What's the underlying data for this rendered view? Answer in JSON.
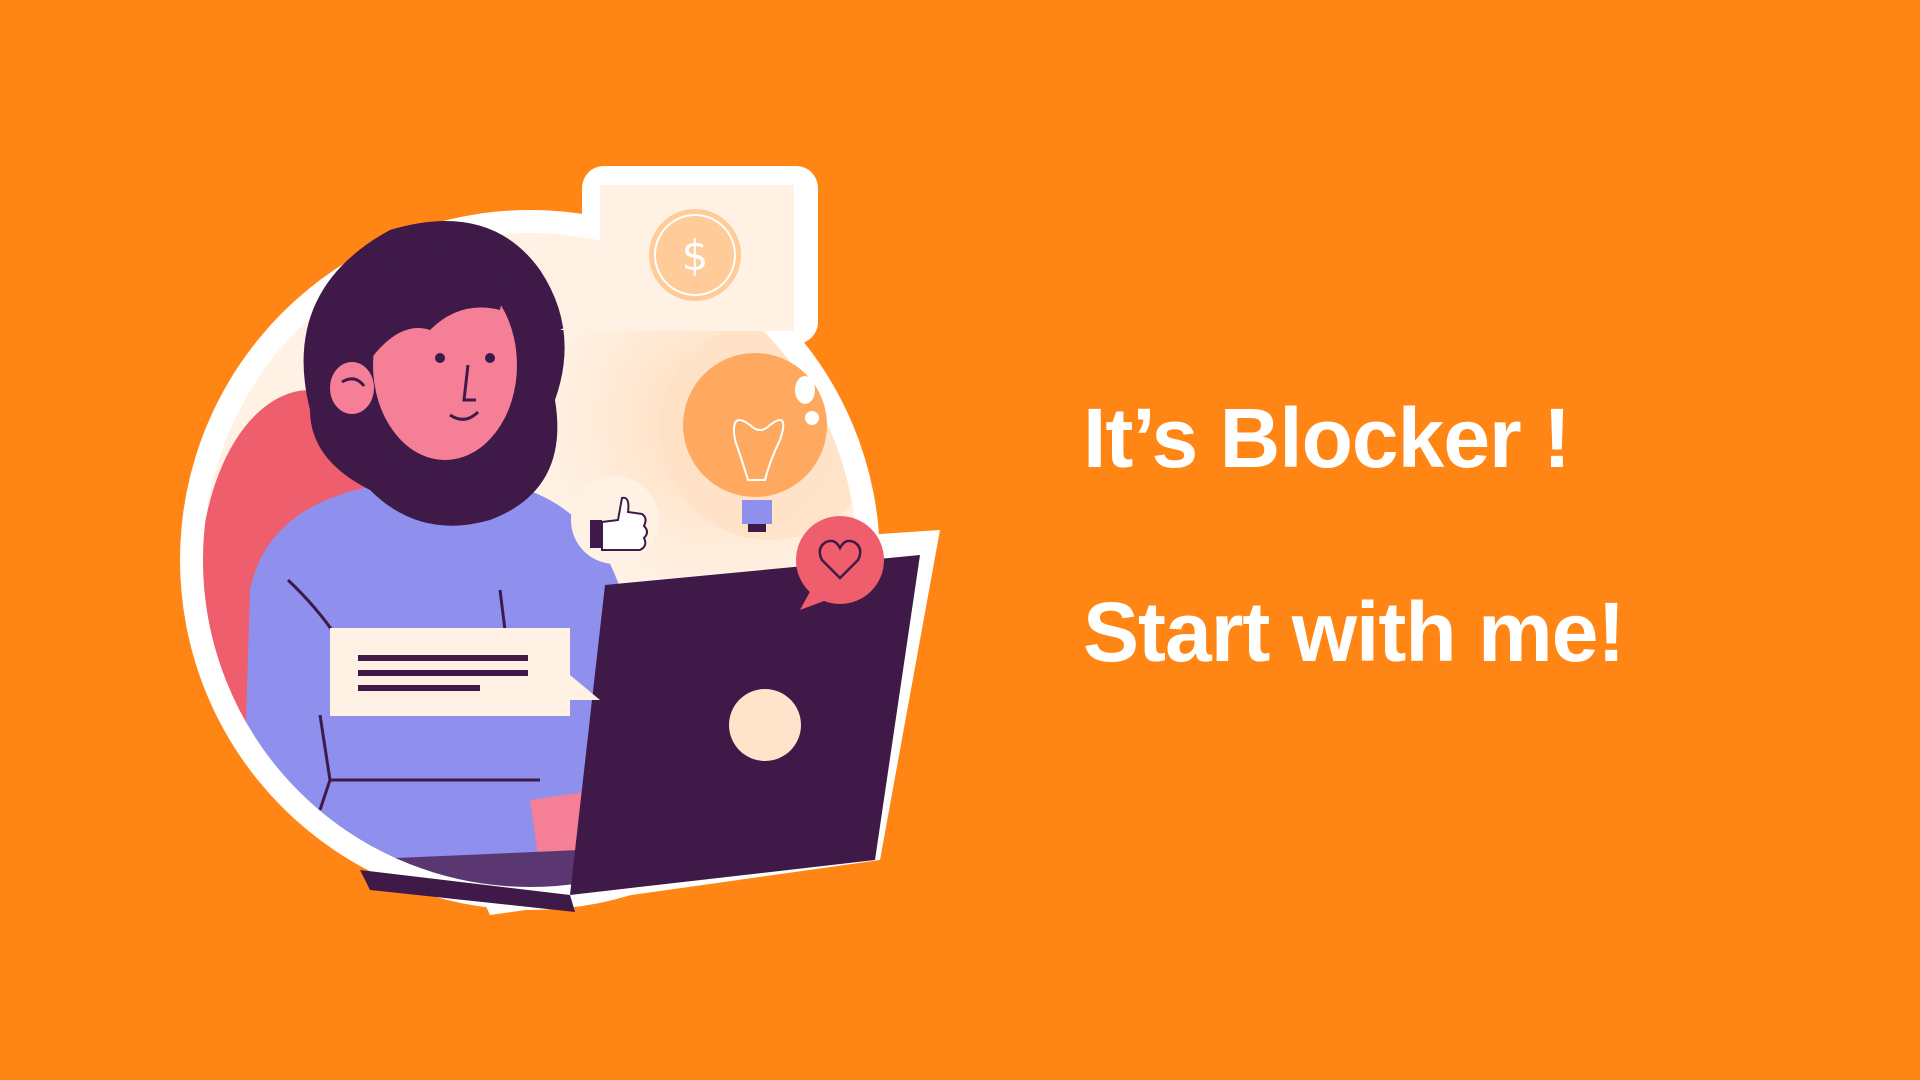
{
  "colors": {
    "background": "#FF8515",
    "text": "#FFFFFF",
    "hair": "#3F1A48",
    "skin": "#F57F96",
    "shirt": "#8F90EE",
    "laptop": "#3F1A48",
    "chair": "#EE5E6D",
    "bulb": "#FFA860",
    "coin": "#FFCB98",
    "cream": "#FFF1E4"
  },
  "headline": {
    "line1": "It’s Blocker !",
    "line2": "Start with me!"
  },
  "icons": [
    "woman-illustration",
    "dollar-coin-icon",
    "lightbulb-icon",
    "thumbs-up-icon",
    "heart-bubble-icon",
    "laptop-icon",
    "message-bubble-icon"
  ]
}
